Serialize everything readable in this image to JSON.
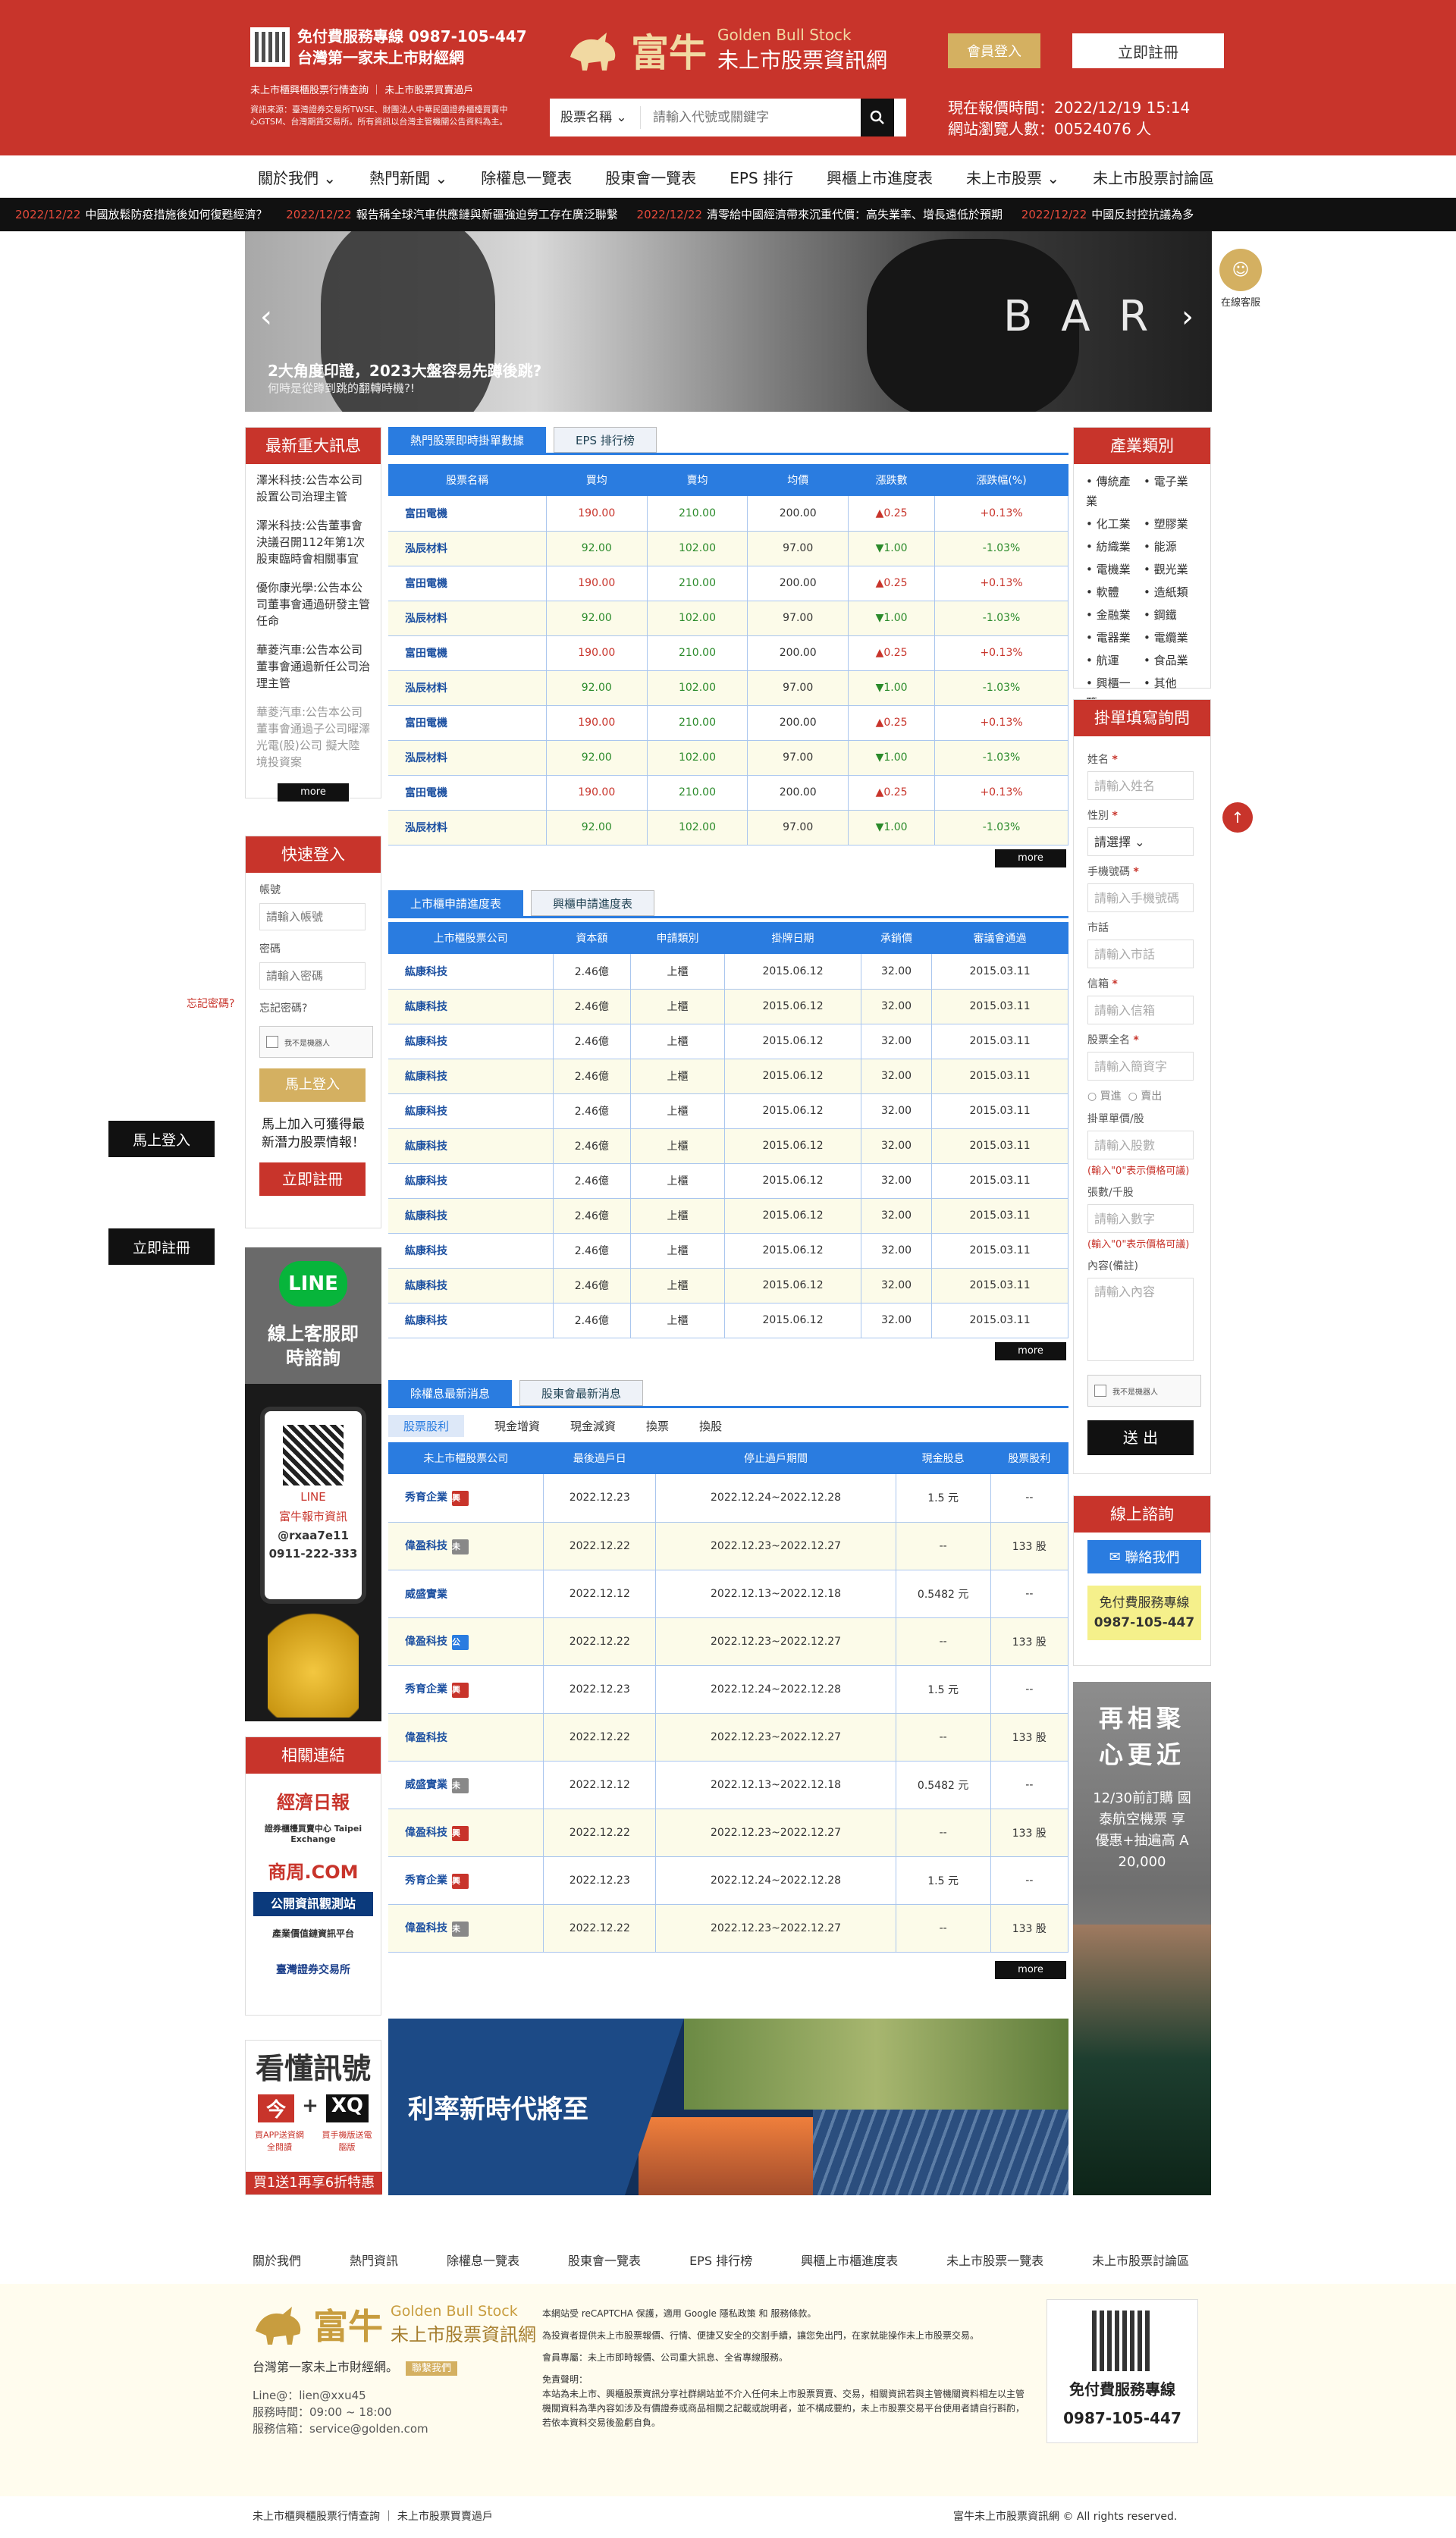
{
  "header": {
    "hotline": "免付費服務專線 0987-105-447",
    "tagline": "台灣第一家未上市財經網",
    "note1": "未上市櫃興櫃股票行情查詢 ｜ 未上市股票買賣過戶",
    "note2": "資訊來源：臺灣證券交易所TWSE、財團法人中華民國證券櫃檯買賣中心GTSM、台灣期貨交易所。所有資訊以台灣主管機關公告資料為主。",
    "brand_zh": "富牛",
    "brand_en": "Golden Bull Stock",
    "brand_sub": "未上市股票資訊網",
    "login": "會員登入",
    "register": "立即註冊",
    "search_select": "股票名稱",
    "search_placeholder": "請輸入代號或關鍵字",
    "quote_time": "現在報價時間：2022/12/19 15:14",
    "visitors": "網站瀏覽人數：00524076 人"
  },
  "nav": [
    "關於我們",
    "熱門新聞",
    "除權息一覽表",
    "股東會一覽表",
    "EPS 排行",
    "興櫃上市進度表",
    "未上市股票",
    "未上市股票討論區"
  ],
  "ticker": [
    {
      "date": "2022/12/22",
      "text": "中國放鬆防疫措施後如何復甦經濟？"
    },
    {
      "date": "2022/12/22",
      "text": "報告稱全球汽車供應鏈與新疆強迫勞工存在廣泛聯繫"
    },
    {
      "date": "2022/12/22",
      "text": "清零給中國經濟帶來沉重代價：高失業率、增長遠低於預期"
    },
    {
      "date": "2022/12/22",
      "text": "中國反封控抗議為多"
    }
  ],
  "banner": {
    "bar": "B A R",
    "title": "2大角度印證，2023大盤容易先蹲後跳?",
    "subtitle": "何時是從蹲到跳的翻轉時機?!"
  },
  "service": "在線客服",
  "float_login": "馬上登入",
  "float_register": "立即註冊",
  "news": {
    "title": "最新重大訊息",
    "items": [
      "澤米科技:公告本公司設置公司治理主管",
      "澤米科技:公告董事會決議召開112年第1次股東臨時會相關事宜",
      "優你康光學:公告本公司董事會通過研發主管任命",
      "華菱汽車:公告本公司董事會通過新任公司治理主管",
      "華菱汽車:公告本公司董事會通過子公司曜澤光電(股)公司 擬大陸境投資案"
    ],
    "more": "more"
  },
  "login_box": {
    "title": "快速登入",
    "account_label": "帳號",
    "account_ph": "請輸入帳號",
    "pw_label": "密碼",
    "pw_ph": "請輸入密碼",
    "forgot": "忘記密碼?",
    "forgot_left": "忘記密碼?",
    "recaptcha": "我不是機器人",
    "btn": "馬上登入",
    "promo": "馬上加入可獲得最新潛力股票情報！",
    "reg": "立即註冊"
  },
  "ad_line": {
    "brand": "LINE",
    "title": "線上客服即時諮詢",
    "line_label": "LINE",
    "name": "富牛報市資訊",
    "id": "@rxaa7e11",
    "phone": "0911-222-333"
  },
  "links": {
    "title": "相關連結",
    "items": [
      "經濟日報",
      "證券櫃檯買賣中心 Taipei Exchange",
      "商周.COM",
      "公開資訊觀測站",
      "產業價值鏈資訊平台",
      "臺灣證券交易所"
    ]
  },
  "ad_signal": {
    "title": "看懂訊號",
    "a": "今",
    "b": "XQ",
    "left": "買APP送資網全閱讀",
    "right": "買手機版送電腦版",
    "foot": "買1送1再享6折特惠"
  },
  "ad_rate": "利率新時代將至",
  "ad_travel": {
    "line1": "再相聚",
    "line2": "心更近",
    "small": "12/30前訂購 國泰航空機票 享優惠+抽遍高 A 20,000"
  },
  "t1": {
    "tabs": [
      "熱門股票即時掛單數據",
      "EPS 排行榜"
    ],
    "headers": [
      "股票名稱",
      "買均",
      "賣均",
      "均價",
      "漲跌數",
      "漲跌幅(%)"
    ],
    "rows": [
      [
        "富田電機",
        "190.00",
        "210.00",
        "200.00",
        "▲0.25",
        "+0.13%",
        "u"
      ],
      [
        "泓辰材料",
        "92.00",
        "102.00",
        "97.00",
        "▼1.00",
        "-1.03%",
        "d"
      ],
      [
        "富田電機",
        "190.00",
        "210.00",
        "200.00",
        "▲0.25",
        "+0.13%",
        "u"
      ],
      [
        "泓辰材料",
        "92.00",
        "102.00",
        "97.00",
        "▼1.00",
        "-1.03%",
        "d"
      ],
      [
        "富田電機",
        "190.00",
        "210.00",
        "200.00",
        "▲0.25",
        "+0.13%",
        "u"
      ],
      [
        "泓辰材料",
        "92.00",
        "102.00",
        "97.00",
        "▼1.00",
        "-1.03%",
        "d"
      ],
      [
        "富田電機",
        "190.00",
        "210.00",
        "200.00",
        "▲0.25",
        "+0.13%",
        "u"
      ],
      [
        "泓辰材料",
        "92.00",
        "102.00",
        "97.00",
        "▼1.00",
        "-1.03%",
        "d"
      ],
      [
        "富田電機",
        "190.00",
        "210.00",
        "200.00",
        "▲0.25",
        "+0.13%",
        "u"
      ],
      [
        "泓辰材料",
        "92.00",
        "102.00",
        "97.00",
        "▼1.00",
        "-1.03%",
        "d"
      ]
    ],
    "more": "more"
  },
  "t2": {
    "tabs": [
      "上市櫃申請進度表",
      "興櫃申請進度表"
    ],
    "headers": [
      "上市櫃股票公司",
      "資本額",
      "申請類別",
      "掛牌日期",
      "承銷價",
      "審議會通過"
    ],
    "rows": [
      [
        "紘康科技",
        "2.46億",
        "上櫃",
        "2015.06.12",
        "32.00",
        "2015.03.11"
      ],
      [
        "紘康科技",
        "2.46億",
        "上櫃",
        "2015.06.12",
        "32.00",
        "2015.03.11"
      ],
      [
        "紘康科技",
        "2.46億",
        "上櫃",
        "2015.06.12",
        "32.00",
        "2015.03.11"
      ],
      [
        "紘康科技",
        "2.46億",
        "上櫃",
        "2015.06.12",
        "32.00",
        "2015.03.11"
      ],
      [
        "紘康科技",
        "2.46億",
        "上櫃",
        "2015.06.12",
        "32.00",
        "2015.03.11"
      ],
      [
        "紘康科技",
        "2.46億",
        "上櫃",
        "2015.06.12",
        "32.00",
        "2015.03.11"
      ],
      [
        "紘康科技",
        "2.46億",
        "上櫃",
        "2015.06.12",
        "32.00",
        "2015.03.11"
      ],
      [
        "紘康科技",
        "2.46億",
        "上櫃",
        "2015.06.12",
        "32.00",
        "2015.03.11"
      ],
      [
        "紘康科技",
        "2.46億",
        "上櫃",
        "2015.06.12",
        "32.00",
        "2015.03.11"
      ],
      [
        "紘康科技",
        "2.46億",
        "上櫃",
        "2015.06.12",
        "32.00",
        "2015.03.11"
      ],
      [
        "紘康科技",
        "2.46億",
        "上櫃",
        "2015.06.12",
        "32.00",
        "2015.03.11"
      ]
    ],
    "more": "more"
  },
  "t3": {
    "tabs": [
      "除權息最新消息",
      "股東會最新消息"
    ],
    "subtabs": [
      "股票股利",
      "現金增資",
      "現金減資",
      "換票",
      "換股"
    ],
    "headers": [
      "未上市櫃股票公司",
      "最後過戶日",
      "停止過戶期間",
      "現金股息",
      "股票股利"
    ],
    "rows": [
      [
        "秀育企業",
        "興",
        "2022.12.23",
        "2022.12.24~2022.12.28",
        "1.5 元",
        "--"
      ],
      [
        "偉盈科技",
        "未",
        "2022.12.22",
        "2022.12.23~2022.12.27",
        "--",
        "133 股"
      ],
      [
        "威盛實業",
        "",
        "2022.12.12",
        "2022.12.13~2022.12.18",
        "0.5482 元",
        "--"
      ],
      [
        "偉盈科技",
        "公",
        "2022.12.22",
        "2022.12.23~2022.12.27",
        "--",
        "133 股"
      ],
      [
        "秀育企業",
        "興",
        "2022.12.23",
        "2022.12.24~2022.12.28",
        "1.5 元",
        "--"
      ],
      [
        "偉盈科技",
        "",
        "2022.12.22",
        "2022.12.23~2022.12.27",
        "--",
        "133 股"
      ],
      [
        "威盛實業",
        "未",
        "2022.12.12",
        "2022.12.13~2022.12.18",
        "0.5482 元",
        "--"
      ],
      [
        "偉盈科技",
        "興",
        "2022.12.22",
        "2022.12.23~2022.12.27",
        "--",
        "133 股"
      ],
      [
        "秀育企業",
        "興",
        "2022.12.23",
        "2022.12.24~2022.12.28",
        "1.5 元",
        "--"
      ],
      [
        "偉盈科技",
        "未",
        "2022.12.22",
        "2022.12.23~2022.12.27",
        "--",
        "133 股"
      ]
    ],
    "more": "more"
  },
  "categories": {
    "title": "產業類別",
    "items": [
      "傳統產業",
      "電子業",
      "化工業",
      "塑膠業",
      "紡織業",
      "能源",
      "電機業",
      "觀光業",
      "軟體",
      "造紙類",
      "金融業",
      "鋼鐵",
      "電器業",
      "電纜業",
      "航運",
      "食品業",
      "興櫃一覽",
      "其他"
    ]
  },
  "order_form": {
    "title": "掛單填寫詢問",
    "name_label": "姓名",
    "name_ph": "請輸入姓名",
    "gender_label": "性別",
    "gender_val": "請選擇",
    "phone_label": "手機號碼",
    "phone_ph": "請輸入手機號碼",
    "city_label": "市話",
    "city_ph": "請輸入市話",
    "email_label": "信箱",
    "email_ph": "請輸入信箱",
    "stock_label": "股票全名",
    "stock_ph": "請輸入簡資字",
    "buy": "買進",
    "sell": "賣出",
    "price_label": "掛單單價/股",
    "price_ph": "請輸入股數",
    "hint": "(輸入\"0\"表示價格可議)",
    "qty_label": "張數/千股",
    "qty_ph": "請輸入數字",
    "hint2": "(輸入\"0\"表示價格可議)",
    "content_label": "內容(備註)",
    "content_ph": "請輸入內容",
    "recaptcha": "我不是機器人",
    "submit": "送 出"
  },
  "online": {
    "title": "線上諮詢",
    "contact": "聯絡我們",
    "hotline_label": "免付費服務專線",
    "hotline": "0987-105-447"
  },
  "footer_nav": [
    "關於我們",
    "熱門資訊",
    "除權息一覽表",
    "股東會一覽表",
    "EPS 排行榜",
    "興櫃上市櫃進度表",
    "未上市股票一覽表",
    "未上市股票討論區"
  ],
  "footer": {
    "tagline": "台灣第一家未上市財經網。",
    "tag_btn": "聯繫我們",
    "line": "Line@：lien@xxu45",
    "hours": "服務時間：09:00 ~ 18:00",
    "email": "服務信箱：service@golden.com",
    "recaptcha_note": "本網站受 reCAPTCHA 保護，適用 Google 隱私政策 和 服務條款。",
    "p1": "為投資者提供未上市股票報價、行情、便捷又安全的交割手續，讓您免出門，在家就能操作未上市股票交易。",
    "p2": "會員專屬：未上市即時報價、公司重大訊息、全省專線服務。",
    "disclaimer_title": "免責聲明：",
    "disclaimer": "本站為未上市、興櫃股票資訊分享社群網站並不介入任何未上市股票買賣、交易，相關資訊若與主管機關資料相左以主管機關資料為準內容如涉及有價證券或商品相關之記載或說明者，並不構成要約，未上市股票交易平台使用者請自行斟酌，若依本資料交易後盈虧自負。",
    "qr_title": "免付費服務專線",
    "qr_phone": "0987-105-447"
  },
  "copyright": {
    "left": "未上市櫃興櫃股票行情查詢 ｜ 未上市股票買賣過戶",
    "right": "富牛未上市股票資訊網 © All rights reserved."
  }
}
